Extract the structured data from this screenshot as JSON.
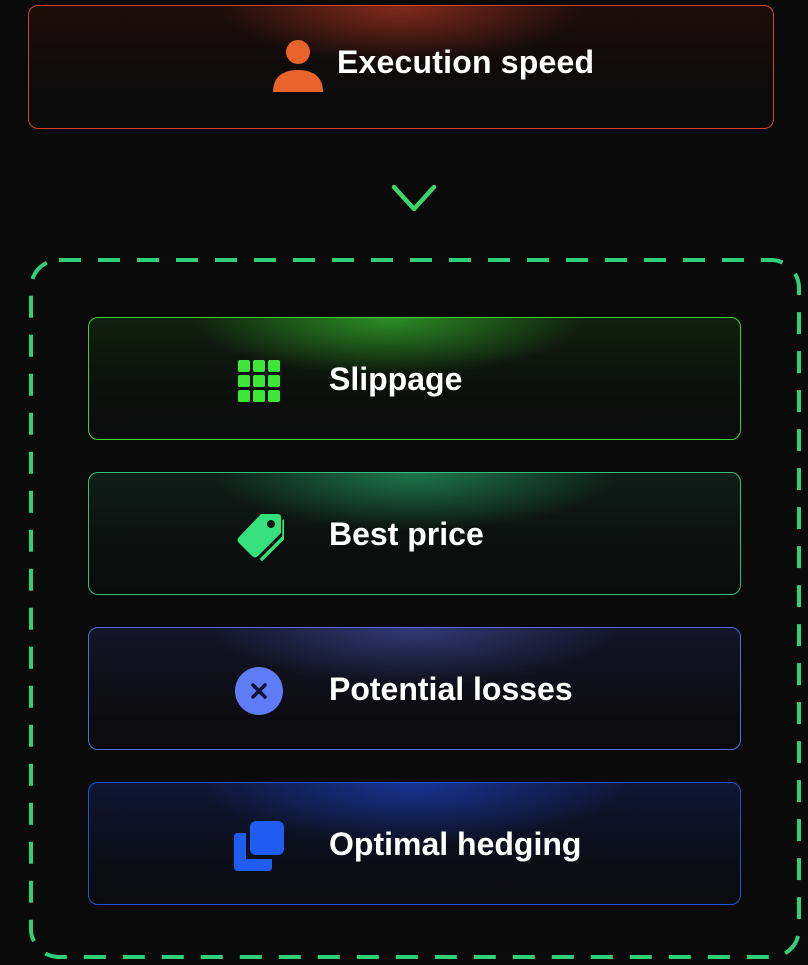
{
  "top": {
    "label": "Execution speed",
    "icon": "user-icon",
    "accent": "#e8642c"
  },
  "arrow": {
    "icon": "arrow-down-icon",
    "color": "#3dd56a"
  },
  "group": {
    "border_color": "#2fd07a",
    "items": [
      {
        "label": "Slippage",
        "icon": "grid-icon",
        "accent": "#3fe63a"
      },
      {
        "label": "Best price",
        "icon": "tag-icon",
        "accent": "#36e07a"
      },
      {
        "label": "Potential losses",
        "icon": "close-circle-icon",
        "accent": "#5e7cf5"
      },
      {
        "label": "Optimal hedging",
        "icon": "copy-icon",
        "accent": "#1f5cf2"
      }
    ]
  }
}
